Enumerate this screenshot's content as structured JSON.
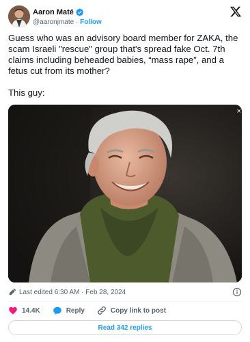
{
  "author": {
    "display_name": "Aaron Maté",
    "handle": "@aaronjmate",
    "separator": "·",
    "follow_label": "Follow",
    "verified": true
  },
  "tweet": {
    "text_line1": "Guess who was an advisory board member for ZAKA, the scam Israeli \"rescue\" group that's spread fake Oct. 7th claims including beheaded babies, “mass rape”, and a fetus cut from its mother?",
    "text_line2": "This guy:"
  },
  "meta": {
    "edited_label": "Last edited 6:30 AM · Feb 28, 2024"
  },
  "actions": {
    "likes_count": "14.4K",
    "reply_label": "Reply",
    "copy_link_label": "Copy link to post"
  },
  "footer": {
    "read_replies_label": "Read 342 replies"
  },
  "colors": {
    "accent": "#1d9bf0",
    "like": "#f91880",
    "secondary_text": "#536471"
  },
  "icons": [
    "verified-badge-icon",
    "x-logo-icon",
    "pencil-icon",
    "info-icon",
    "heart-icon",
    "reply-icon",
    "link-icon"
  ]
}
